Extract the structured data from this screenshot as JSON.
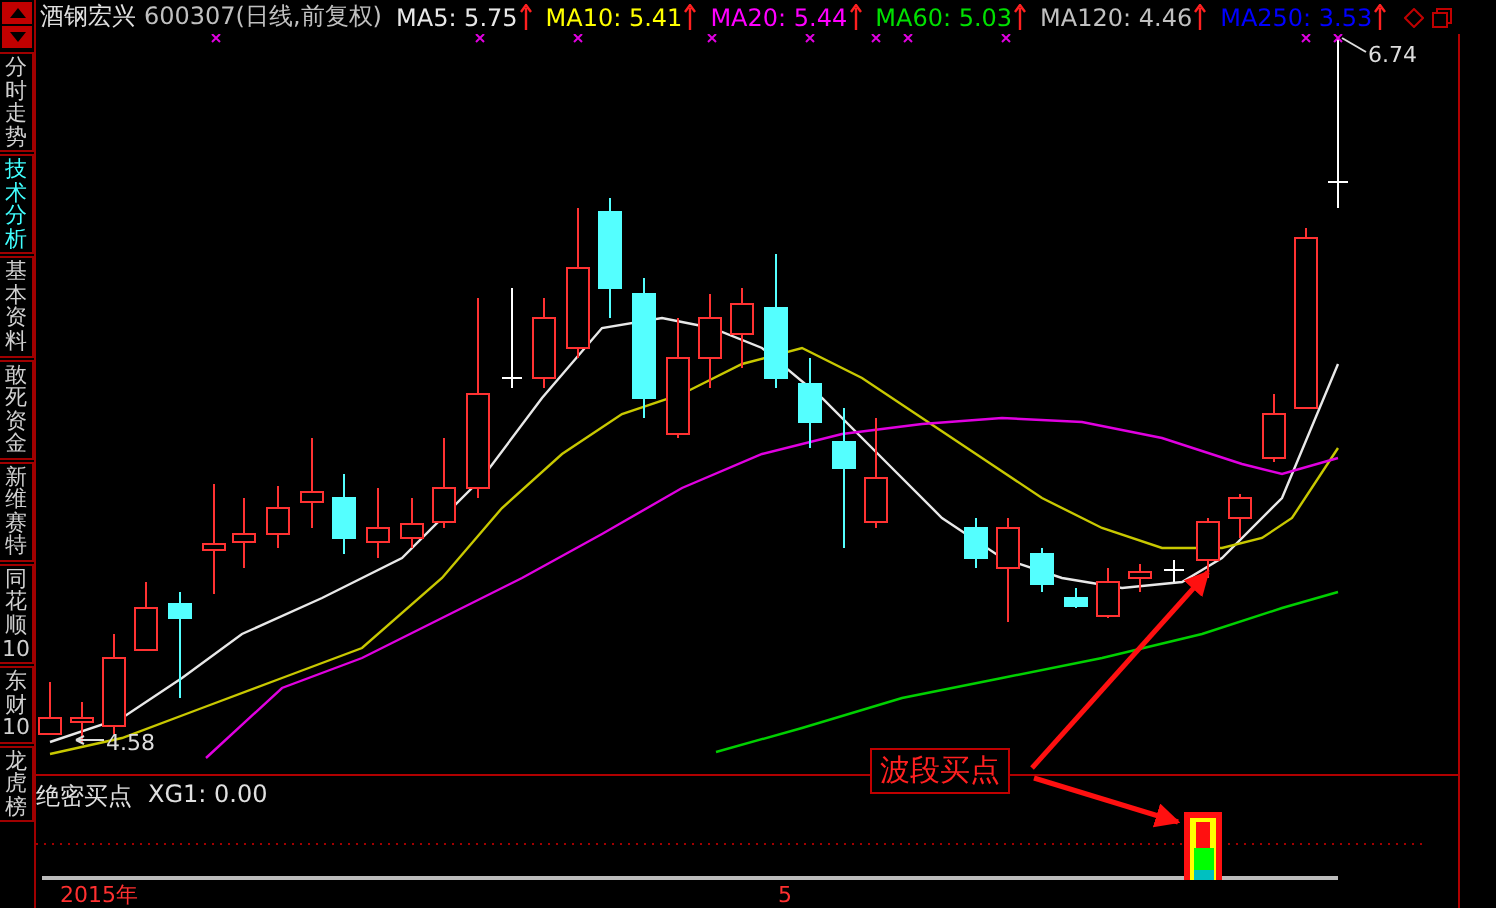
{
  "side_tabs": [
    {
      "label": "分时走势",
      "selected": false
    },
    {
      "label": "技术分析",
      "selected": true
    },
    {
      "label": "基本资料",
      "selected": false
    },
    {
      "label": "敢死资金",
      "selected": false
    },
    {
      "label": "新维赛特",
      "selected": false
    },
    {
      "label": "同花顺10",
      "selected": false
    },
    {
      "label": "东财10",
      "selected": false
    },
    {
      "label": "龙虎榜",
      "selected": false
    }
  ],
  "stock": {
    "name": "酒钢宏兴",
    "code": "600307(日线,前复权)"
  },
  "moving_averages": [
    {
      "label": "MA5: 5.75",
      "color": "#e8e8e8"
    },
    {
      "label": "MA10: 5.41",
      "color": "#ffff00"
    },
    {
      "label": "MA20: 5.44",
      "color": "#ff00ff"
    },
    {
      "label": "MA60: 5.03",
      "color": "#00e000"
    },
    {
      "label": "MA120: 4.46",
      "color": "#c0c0c0"
    },
    {
      "label": "MA250: 3.53",
      "color": "#0000ff"
    }
  ],
  "price_labels": {
    "high": "6.74",
    "low": "4.58"
  },
  "annotation": {
    "text": "波段买点"
  },
  "indicator": {
    "title": "绝密买点",
    "reading": "XG1: 0.00"
  },
  "time_axis": [
    "2015年",
    "5"
  ]
}
